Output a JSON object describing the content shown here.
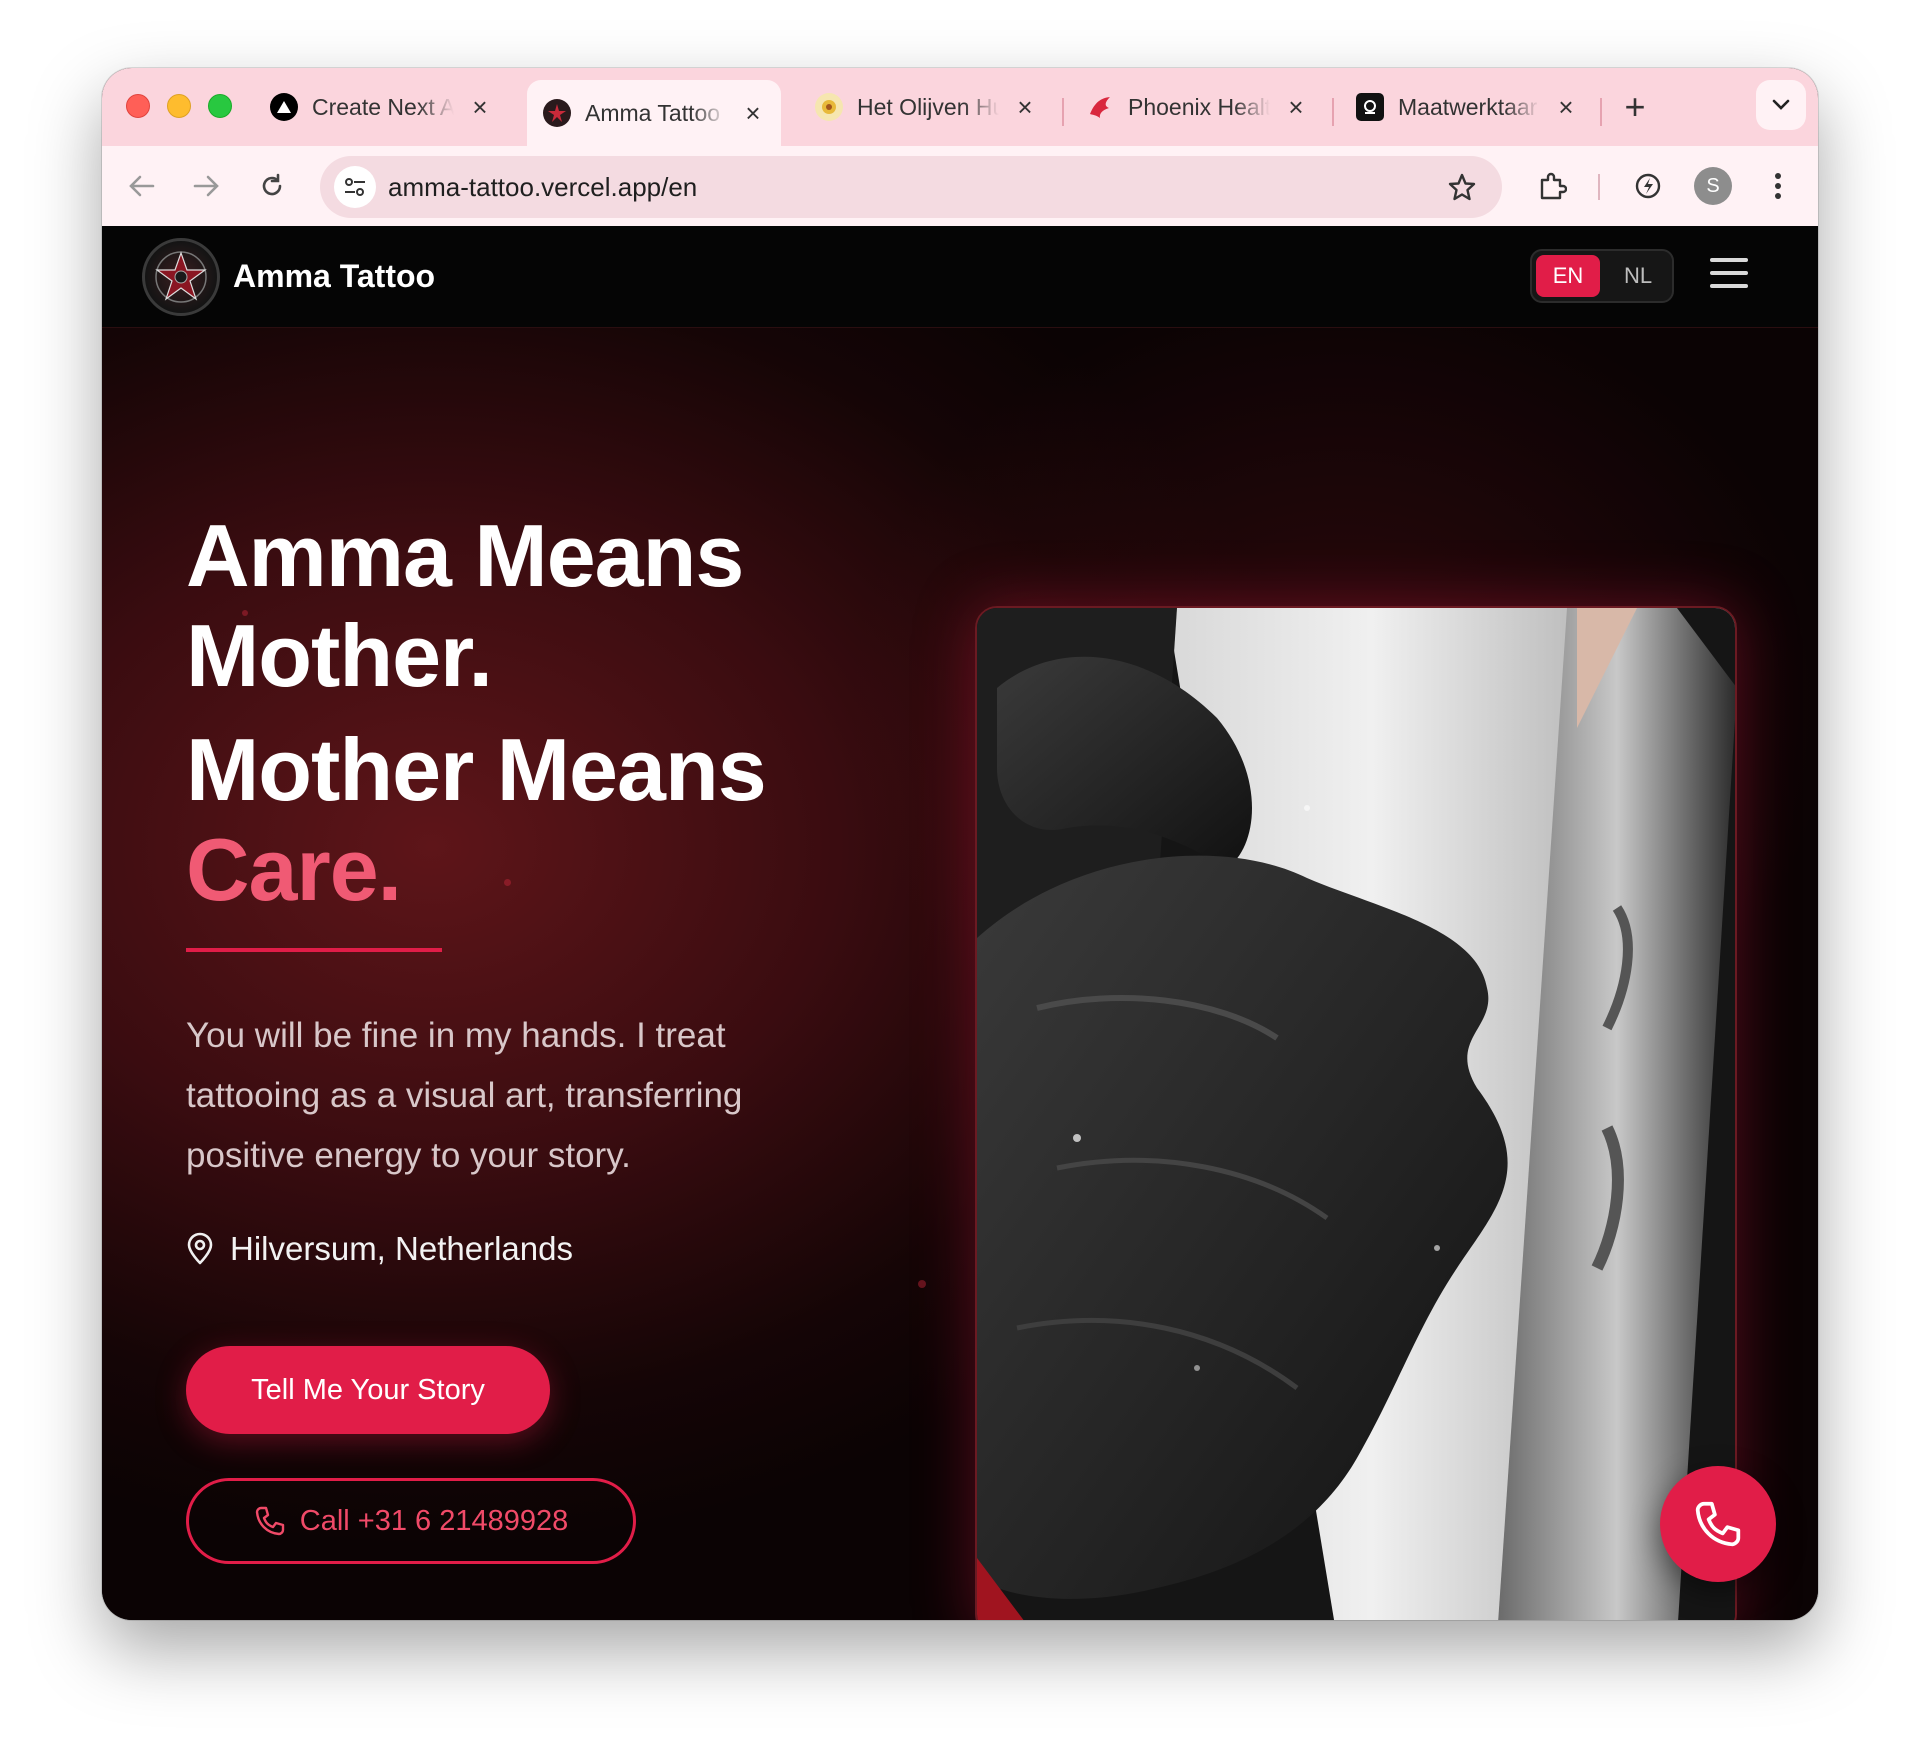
{
  "browser": {
    "tabs": [
      {
        "title": "Create Next A",
        "icon": "triangle-logo-icon"
      },
      {
        "title": "Amma Tattoo",
        "icon": "amma-logo-icon",
        "active": true
      },
      {
        "title": "Het Olijven Hu",
        "icon": "olive-logo-icon"
      },
      {
        "title": "Phoenix Healt",
        "icon": "phoenix-logo-icon"
      },
      {
        "title": "Maatwerktaar",
        "icon": "maatwerk-logo-icon"
      }
    ],
    "url": "amma-tattoo.vercel.app/en",
    "profile_initial": "S"
  },
  "site": {
    "brand": "Amma Tattoo",
    "lang": {
      "en": "EN",
      "nl": "NL",
      "selected": "EN"
    }
  },
  "hero": {
    "title_line1": "Amma Means",
    "title_line2": "Mother.",
    "title_line3": "Mother Means",
    "title_accent": "Care.",
    "body": "You will be fine in my hands. I treat tattooing as a visual art, transferring positive energy to your story.",
    "location": "Hilversum, Netherlands",
    "cta_primary": "Tell Me Your Story",
    "cta_call": "Call +31 6 21489928"
  },
  "colors": {
    "accent": "#e11d48",
    "accent_text": "#f05a74",
    "tab_strip": "#fbd5dd",
    "toolbar": "#fff2f5"
  }
}
